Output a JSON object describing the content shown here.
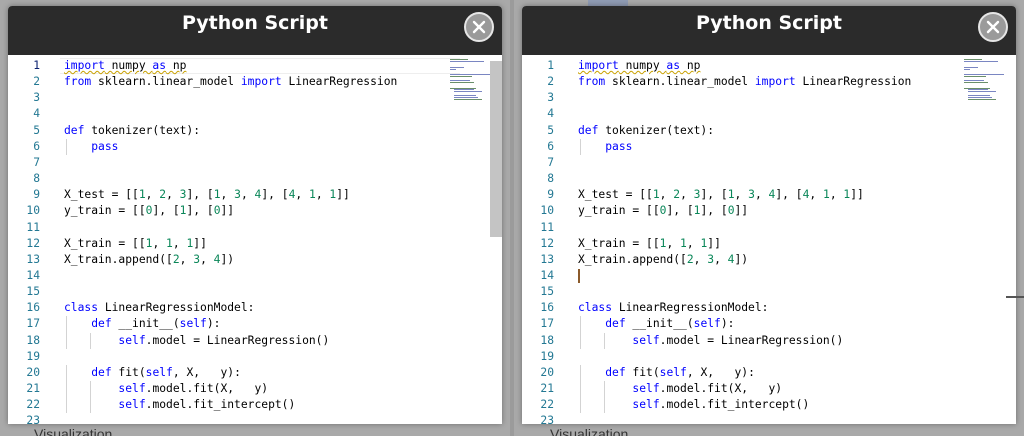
{
  "window_title": "Python Script",
  "background_label": "Visualization",
  "panels": [
    {
      "id": "left",
      "lines": [
        {
          "n": "1",
          "segs": [
            [
              "kw",
              "import"
            ],
            [
              "",
              ""
            ],
            [
              "txt",
              " numpy "
            ],
            [
              "kw",
              "as"
            ],
            [
              "txt",
              " np"
            ]
          ],
          "squiggle": true
        },
        {
          "n": "2",
          "segs": [
            [
              "kw",
              "from"
            ],
            [
              "txt",
              " sklearn.linear_model "
            ],
            [
              "kw",
              "import"
            ],
            [
              "txt",
              " LinearRegression"
            ]
          ]
        },
        {
          "n": "3",
          "segs": []
        },
        {
          "n": "4",
          "segs": []
        },
        {
          "n": "5",
          "segs": [
            [
              "kw",
              "def"
            ],
            [
              "txt",
              " tokenizer(text):"
            ]
          ]
        },
        {
          "n": "6",
          "segs": [
            [
              "txt",
              "    "
            ],
            [
              "kw",
              "pass"
            ]
          ]
        },
        {
          "n": "7",
          "segs": []
        },
        {
          "n": "8",
          "segs": []
        },
        {
          "n": "9",
          "segs": [
            [
              "txt",
              "X_test = [["
            ],
            [
              "num",
              "1"
            ],
            [
              "txt",
              ", "
            ],
            [
              "num",
              "2"
            ],
            [
              "txt",
              ", "
            ],
            [
              "num",
              "3"
            ],
            [
              "txt",
              "], ["
            ],
            [
              "num",
              "1"
            ],
            [
              "txt",
              ", "
            ],
            [
              "num",
              "3"
            ],
            [
              "txt",
              ", "
            ],
            [
              "num",
              "4"
            ],
            [
              "txt",
              "], ["
            ],
            [
              "num",
              "4"
            ],
            [
              "txt",
              ", "
            ],
            [
              "num",
              "1"
            ],
            [
              "txt",
              ", "
            ],
            [
              "num",
              "1"
            ],
            [
              "txt",
              "]]"
            ]
          ]
        },
        {
          "n": "10",
          "segs": [
            [
              "txt",
              "y_train = [["
            ],
            [
              "num",
              "0"
            ],
            [
              "txt",
              "], ["
            ],
            [
              "num",
              "1"
            ],
            [
              "txt",
              "], ["
            ],
            [
              "num",
              "0"
            ],
            [
              "txt",
              "]]"
            ]
          ]
        },
        {
          "n": "11",
          "segs": []
        },
        {
          "n": "12",
          "segs": [
            [
              "txt",
              "X_train = [["
            ],
            [
              "num",
              "1"
            ],
            [
              "txt",
              ", "
            ],
            [
              "num",
              "1"
            ],
            [
              "txt",
              ", "
            ],
            [
              "num",
              "1"
            ],
            [
              "txt",
              "]]"
            ]
          ]
        },
        {
          "n": "13",
          "segs": [
            [
              "txt",
              "X_train.append(["
            ],
            [
              "num",
              "2"
            ],
            [
              "txt",
              ", "
            ],
            [
              "num",
              "3"
            ],
            [
              "txt",
              ", "
            ],
            [
              "num",
              "4"
            ],
            [
              "txt",
              "])"
            ]
          ]
        },
        {
          "n": "14",
          "segs": []
        },
        {
          "n": "15",
          "segs": []
        },
        {
          "n": "16",
          "segs": [
            [
              "kw",
              "class"
            ],
            [
              "txt",
              " LinearRegressionModel:"
            ]
          ]
        },
        {
          "n": "17",
          "segs": [
            [
              "txt",
              "    "
            ],
            [
              "kw",
              "def"
            ],
            [
              "txt",
              " __init__("
            ],
            [
              "kw",
              "self"
            ],
            [
              "txt",
              "):"
            ]
          ]
        },
        {
          "n": "18",
          "segs": [
            [
              "txt",
              "        "
            ],
            [
              "kw",
              "self"
            ],
            [
              "txt",
              ".model = LinearRegression()"
            ]
          ]
        },
        {
          "n": "19",
          "segs": []
        },
        {
          "n": "20",
          "segs": [
            [
              "txt",
              "    "
            ],
            [
              "kw",
              "def"
            ],
            [
              "txt",
              " fit("
            ],
            [
              "kw",
              "self"
            ],
            [
              "txt",
              ", X,   y):"
            ]
          ]
        },
        {
          "n": "21",
          "segs": [
            [
              "txt",
              "        "
            ],
            [
              "kw",
              "self"
            ],
            [
              "txt",
              ".model.fit(X,   y)"
            ]
          ]
        },
        {
          "n": "22",
          "segs": [
            [
              "txt",
              "        "
            ],
            [
              "kw",
              "self"
            ],
            [
              "txt",
              ".model.fit_intercept()"
            ]
          ]
        },
        {
          "n": "23",
          "segs": []
        }
      ]
    },
    {
      "id": "right",
      "lines": [
        {
          "n": "1",
          "segs": [
            [
              "kw",
              "import"
            ],
            [
              "txt",
              " numpy "
            ],
            [
              "kw",
              "as"
            ],
            [
              "txt",
              " np"
            ]
          ],
          "squiggle": true
        },
        {
          "n": "2",
          "segs": [
            [
              "kw",
              "from"
            ],
            [
              "txt",
              " sklearn.linear_model "
            ],
            [
              "kw",
              "import"
            ],
            [
              "txt",
              " LinearRegression"
            ]
          ]
        },
        {
          "n": "3",
          "segs": []
        },
        {
          "n": "4",
          "segs": []
        },
        {
          "n": "5",
          "segs": [
            [
              "kw",
              "def"
            ],
            [
              "txt",
              " tokenizer(text):"
            ]
          ]
        },
        {
          "n": "6",
          "segs": [
            [
              "txt",
              "    "
            ],
            [
              "kw",
              "pass"
            ]
          ]
        },
        {
          "n": "7",
          "segs": []
        },
        {
          "n": "8",
          "segs": []
        },
        {
          "n": "9",
          "segs": [
            [
              "txt",
              "X_test = [["
            ],
            [
              "num",
              "1"
            ],
            [
              "txt",
              ", "
            ],
            [
              "num",
              "2"
            ],
            [
              "txt",
              ", "
            ],
            [
              "num",
              "3"
            ],
            [
              "txt",
              "], ["
            ],
            [
              "num",
              "1"
            ],
            [
              "txt",
              ", "
            ],
            [
              "num",
              "3"
            ],
            [
              "txt",
              ", "
            ],
            [
              "num",
              "4"
            ],
            [
              "txt",
              "], ["
            ],
            [
              "num",
              "4"
            ],
            [
              "txt",
              ", "
            ],
            [
              "num",
              "1"
            ],
            [
              "txt",
              ", "
            ],
            [
              "num",
              "1"
            ],
            [
              "txt",
              "]]"
            ]
          ]
        },
        {
          "n": "10",
          "segs": [
            [
              "txt",
              "y_train = [["
            ],
            [
              "num",
              "0"
            ],
            [
              "txt",
              "], ["
            ],
            [
              "num",
              "1"
            ],
            [
              "txt",
              "], ["
            ],
            [
              "num",
              "0"
            ],
            [
              "txt",
              "]]"
            ]
          ]
        },
        {
          "n": "11",
          "segs": []
        },
        {
          "n": "12",
          "segs": [
            [
              "txt",
              "X_train = [["
            ],
            [
              "num",
              "1"
            ],
            [
              "txt",
              ", "
            ],
            [
              "num",
              "1"
            ],
            [
              "txt",
              ", "
            ],
            [
              "num",
              "1"
            ],
            [
              "txt",
              "]]"
            ]
          ]
        },
        {
          "n": "13",
          "segs": [
            [
              "txt",
              "X_train.append(["
            ],
            [
              "num",
              "2"
            ],
            [
              "txt",
              ", "
            ],
            [
              "num",
              "3"
            ],
            [
              "txt",
              ", "
            ],
            [
              "num",
              "4"
            ],
            [
              "txt",
              "])"
            ]
          ]
        },
        {
          "n": "14",
          "segs": []
        },
        {
          "n": "15",
          "segs": []
        },
        {
          "n": "16",
          "segs": [
            [
              "kw",
              "class"
            ],
            [
              "txt",
              " LinearRegressionModel:"
            ]
          ]
        },
        {
          "n": "17",
          "segs": [
            [
              "txt",
              "    "
            ],
            [
              "kw",
              "def"
            ],
            [
              "txt",
              " __init__("
            ],
            [
              "kw",
              "self"
            ],
            [
              "txt",
              "):"
            ]
          ]
        },
        {
          "n": "18",
          "segs": [
            [
              "txt",
              "        "
            ],
            [
              "kw",
              "self"
            ],
            [
              "txt",
              ".model = LinearRegression()"
            ]
          ]
        },
        {
          "n": "19",
          "segs": []
        },
        {
          "n": "20",
          "segs": [
            [
              "txt",
              "    "
            ],
            [
              "kw",
              "def"
            ],
            [
              "txt",
              " fit("
            ],
            [
              "kw",
              "self"
            ],
            [
              "txt",
              ", X,   y):"
            ]
          ]
        },
        {
          "n": "21",
          "segs": [
            [
              "txt",
              "        "
            ],
            [
              "kw",
              "self"
            ],
            [
              "txt",
              ".model.fit(X,   y)"
            ]
          ]
        },
        {
          "n": "22",
          "segs": [
            [
              "txt",
              "        "
            ],
            [
              "kw",
              "self"
            ],
            [
              "txt",
              ".model.fit_intercept()"
            ]
          ]
        },
        {
          "n": "23",
          "segs": []
        }
      ]
    }
  ],
  "colors": {
    "keyword": "#0000ff",
    "number": "#098658",
    "line_number": "#237893",
    "titlebar": "#2b2b2b"
  }
}
